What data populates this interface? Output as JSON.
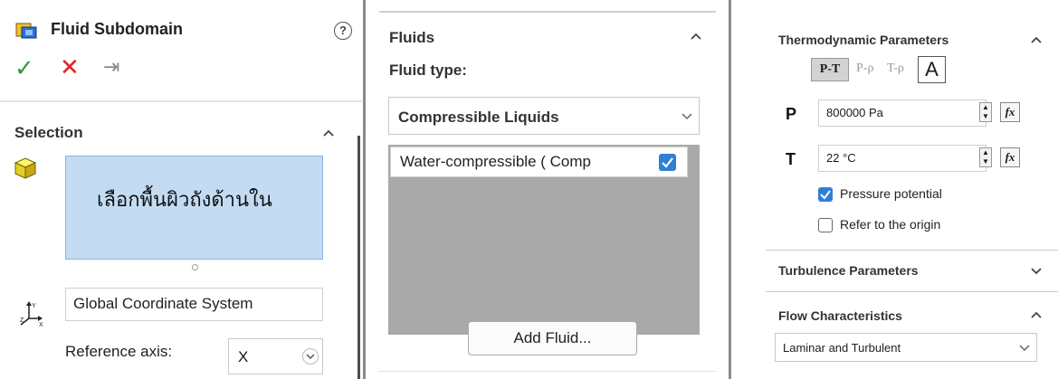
{
  "property_manager": {
    "title": "Fluid Subdomain",
    "selection_section": "Selection",
    "selection_text": "เลือกพื้นผิวถังด้านใน",
    "coordinate_system": "Global Coordinate System",
    "reference_axis_label": "Reference axis:",
    "reference_axis_value": "X",
    "help_symbol": "?",
    "icons": [
      "fluid-subdomain-icon",
      "help-icon",
      "ok-check-icon",
      "cancel-x-icon",
      "pushpin-icon",
      "face-cube-icon",
      "coordinate-axes-icon"
    ]
  },
  "fluids": {
    "section_title": "Fluids",
    "fluid_type_label": "Fluid type:",
    "fluid_type_value": "Compressible Liquids",
    "fluid_items": [
      {
        "name": "Water-compressible ( Comp",
        "checked": true
      }
    ],
    "add_button": "Add Fluid..."
  },
  "thermo": {
    "section_title": "Thermodynamic Parameters",
    "modes": [
      "P-T",
      "P-ρ",
      "T-ρ",
      "A"
    ],
    "active_mode": "P-T",
    "pressure_label": "P",
    "pressure_value": "800000 Pa",
    "temperature_label": "T",
    "temperature_value": "22 °C",
    "fx_label": "fx",
    "pressure_potential_label": "Pressure potential",
    "pressure_potential_checked": true,
    "refer_origin_label": "Refer to the origin",
    "refer_origin_checked": false
  },
  "turbulence": {
    "section_title": "Turbulence Parameters",
    "collapsed": true
  },
  "flow": {
    "section_title": "Flow Characteristics",
    "flow_type_value": "Laminar and Turbulent"
  },
  "colors": {
    "selection_fill": "#c3dcf3",
    "accent_blue": "#2f7fd8",
    "ok_green": "#2e9e2e",
    "cancel_red": "#e02020",
    "list_gray": "#a9a9a9"
  }
}
